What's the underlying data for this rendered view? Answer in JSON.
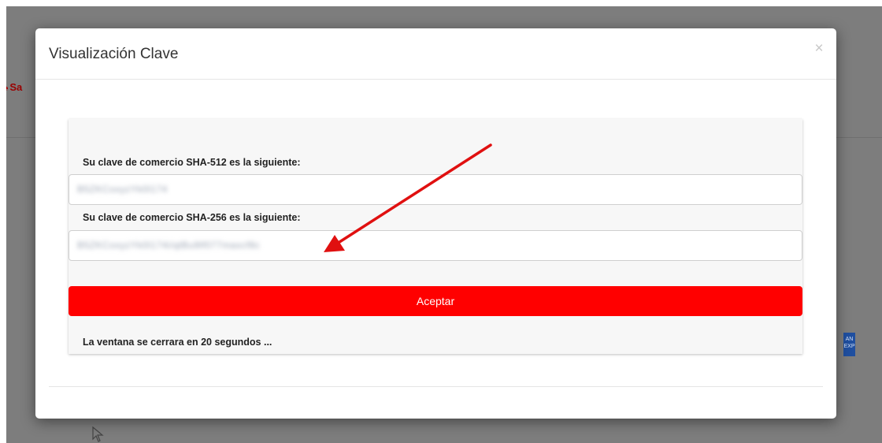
{
  "background": {
    "logo_text": "Sa",
    "card_badge_text": "AN EXP"
  },
  "modal": {
    "title": "Visualización Clave",
    "close_label": "×",
    "sha512_label": "Su clave de comercio SHA-512 es la siguiente:",
    "sha512_value": "B5ZKCoxyzYk0l174",
    "sha256_label": "Su clave de comercio SHA-256 es la siguiente:",
    "sha256_value": "B5ZKCoxyzYk0l174i/qtBu9lf077maxcf8c",
    "accept_label": "Aceptar",
    "countdown_text": "La ventana se cerrara en 20 segundos ..."
  },
  "colors": {
    "accent": "#ff0000",
    "annotation_arrow": "#e01010",
    "overlay": "#7d7d7d"
  }
}
